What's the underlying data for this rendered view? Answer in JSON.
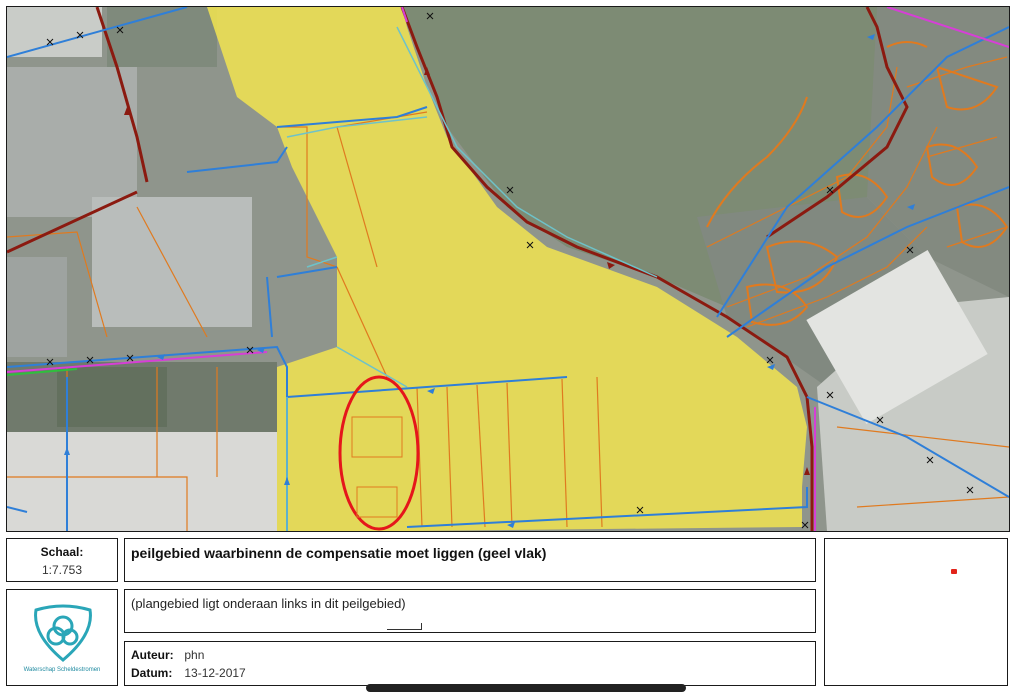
{
  "scale": {
    "label": "Schaal:",
    "value": "1:7.753"
  },
  "title": "peilgebied waarbinenn de compensatie moet liggen (geel vlak)",
  "note": "(plangebied ligt onderaan links in dit peilgebied)",
  "meta": {
    "author_label": "Auteur:",
    "author": "phn",
    "date_label": "Datum:",
    "date": "13-12-2017"
  },
  "logo": {
    "caption": "Waterschap Scheldestromen"
  },
  "map": {
    "peilgebied_color": "#f2e450",
    "highlight_ellipse_color": "#e5161b",
    "watercourse_color": "#2f7fd8",
    "main_watercourse_color": "#8b1a10",
    "parcel_color": "#e07a1f",
    "boundary_color": "#d63fd6",
    "locator_marker_color": "#e2231a"
  }
}
